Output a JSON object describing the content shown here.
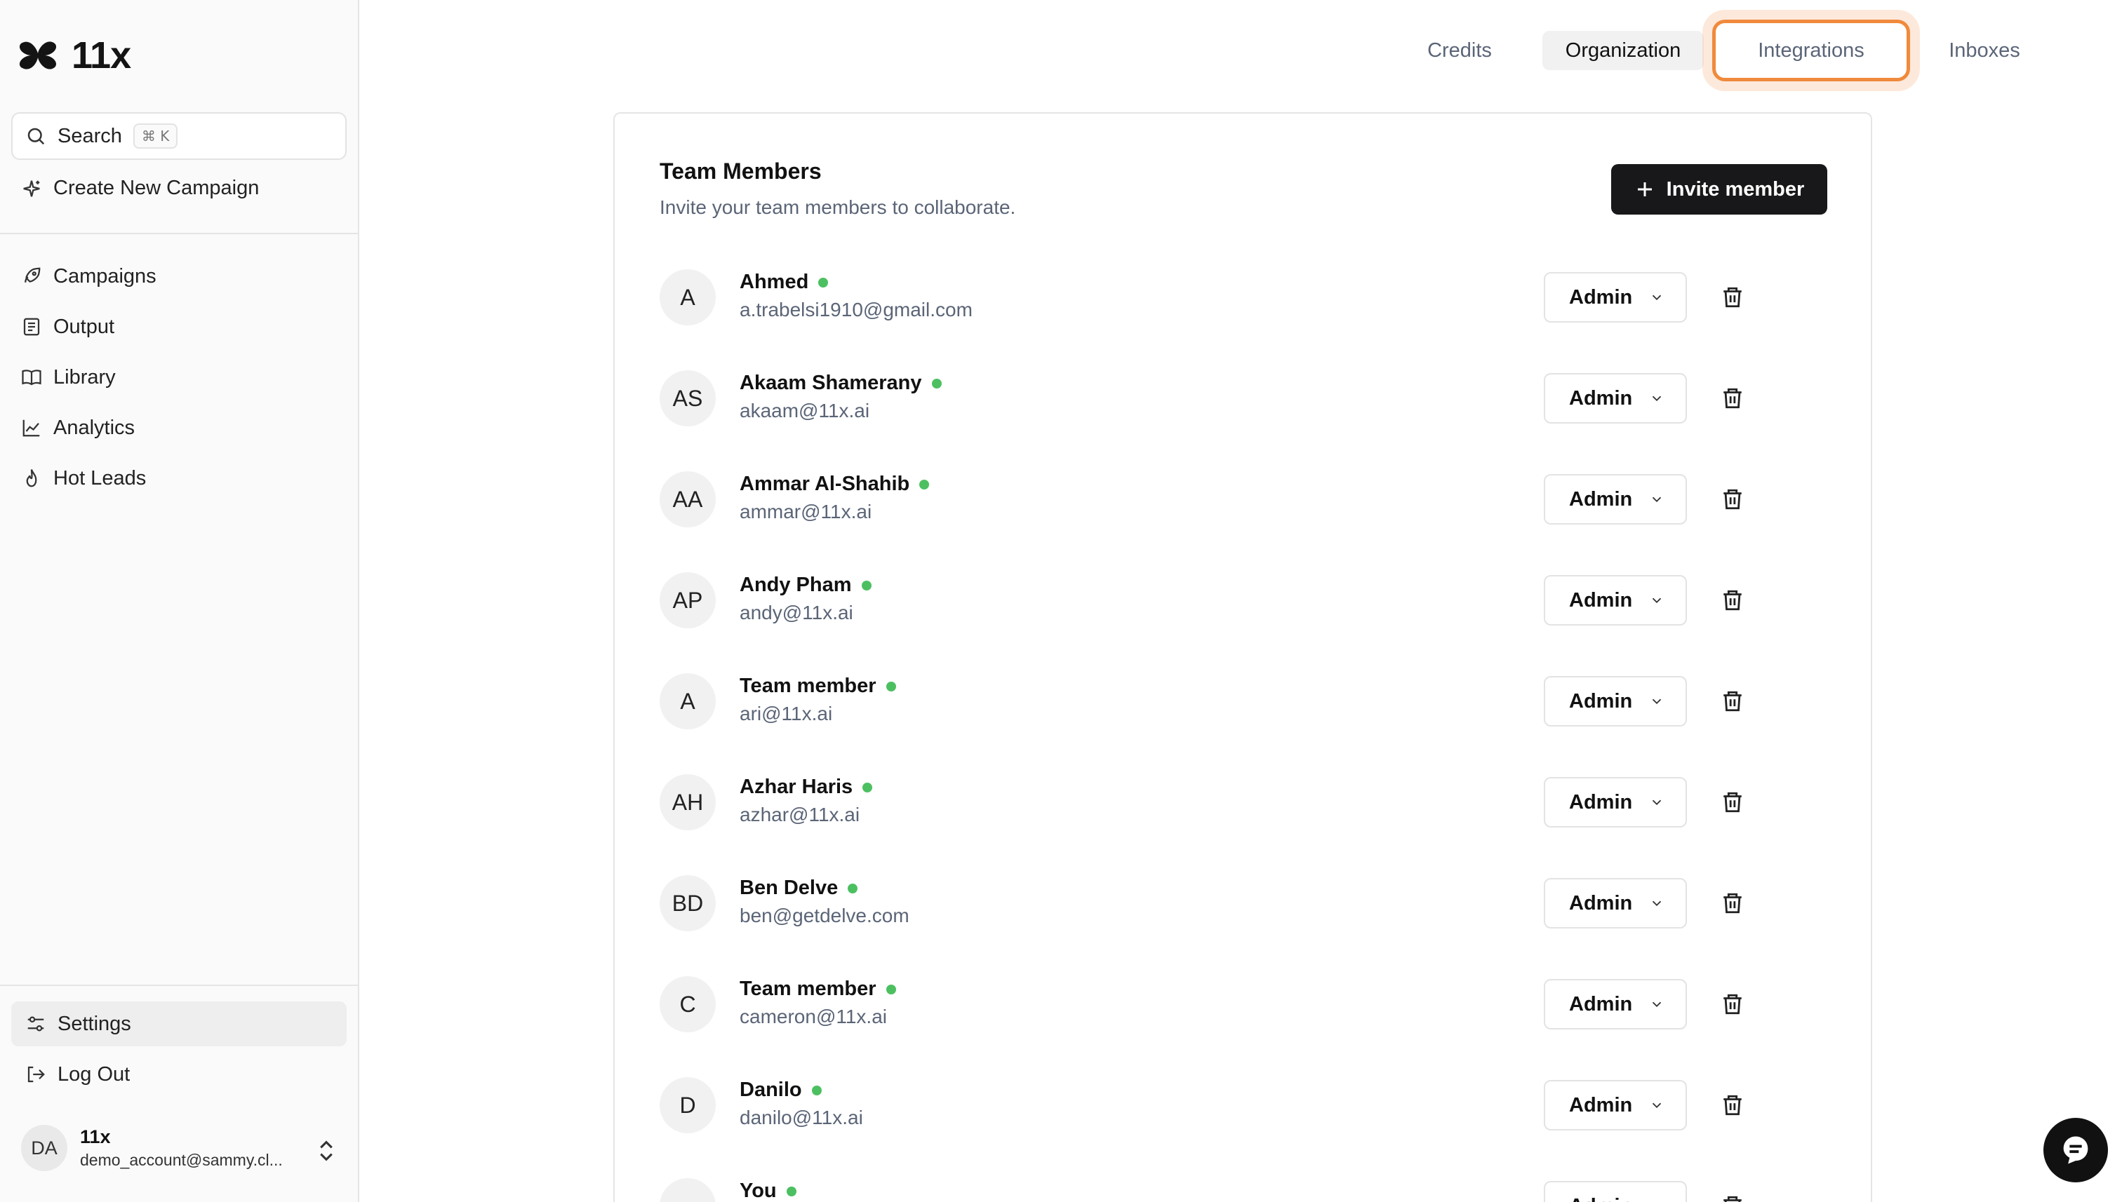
{
  "app": {
    "logo_text": "11x"
  },
  "sidebar": {
    "search": {
      "label": "Search",
      "shortcut": "⌘ K"
    },
    "create_campaign": "Create New Campaign",
    "nav": [
      {
        "label": "Campaigns",
        "icon": "rocket-icon"
      },
      {
        "label": "Output",
        "icon": "document-icon"
      },
      {
        "label": "Library",
        "icon": "book-icon"
      },
      {
        "label": "Analytics",
        "icon": "chart-icon"
      },
      {
        "label": "Hot Leads",
        "icon": "flame-icon"
      }
    ],
    "settings": "Settings",
    "logout": "Log Out",
    "account": {
      "initials": "DA",
      "name": "11x",
      "email": "demo_account@sammy.cl..."
    }
  },
  "tabs": [
    {
      "label": "Credits",
      "state": "default"
    },
    {
      "label": "Organization",
      "state": "selected"
    },
    {
      "label": "Integrations",
      "state": "highlighted"
    },
    {
      "label": "Inboxes",
      "state": "default"
    }
  ],
  "team": {
    "title": "Team Members",
    "subtitle": "Invite your team members to collaborate.",
    "invite_label": "Invite member",
    "members": [
      {
        "initials": "A",
        "name": "Ahmed",
        "email": "a.trabelsi1910@gmail.com",
        "role": "Admin",
        "online": true
      },
      {
        "initials": "AS",
        "name": "Akaam Shamerany",
        "email": "akaam@11x.ai",
        "role": "Admin",
        "online": true
      },
      {
        "initials": "AA",
        "name": "Ammar Al-Shahib",
        "email": "ammar@11x.ai",
        "role": "Admin",
        "online": true
      },
      {
        "initials": "AP",
        "name": "Andy Pham",
        "email": "andy@11x.ai",
        "role": "Admin",
        "online": true
      },
      {
        "initials": "A",
        "name": "Team member",
        "email": "ari@11x.ai",
        "role": "Admin",
        "online": true
      },
      {
        "initials": "AH",
        "name": "Azhar Haris",
        "email": "azhar@11x.ai",
        "role": "Admin",
        "online": true
      },
      {
        "initials": "BD",
        "name": "Ben Delve",
        "email": "ben@getdelve.com",
        "role": "Admin",
        "online": true
      },
      {
        "initials": "C",
        "name": "Team member",
        "email": "cameron@11x.ai",
        "role": "Admin",
        "online": true
      },
      {
        "initials": "D",
        "name": "Danilo",
        "email": "danilo@11x.ai",
        "role": "Admin",
        "online": true
      },
      {
        "initials": "",
        "name": "You",
        "email": "",
        "role": "Admin",
        "online": true
      }
    ]
  },
  "colors": {
    "online_dot": "#4cc061",
    "highlight_ring": "#f08a3c",
    "primary_button": "#18181b"
  }
}
